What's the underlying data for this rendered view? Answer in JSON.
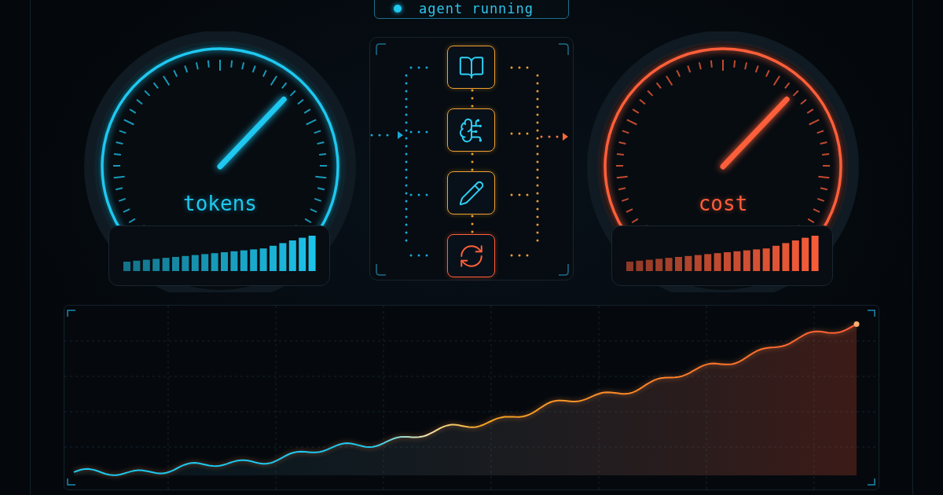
{
  "status": {
    "label": "agent running",
    "running": true
  },
  "gauges": [
    {
      "label": "tokens",
      "level": 0.67,
      "color": "#1ec8f0"
    },
    {
      "label": "cost",
      "level": 0.67,
      "color": "#ff5f3a"
    }
  ],
  "pipeline": {
    "steps": [
      {
        "kind": "book",
        "color": "#f0a030"
      },
      {
        "kind": "brain",
        "color": "#f0a030"
      },
      {
        "kind": "pencil",
        "color": "#f0a030"
      },
      {
        "kind": "refresh",
        "color": "#ff5f3a"
      }
    ]
  }
}
